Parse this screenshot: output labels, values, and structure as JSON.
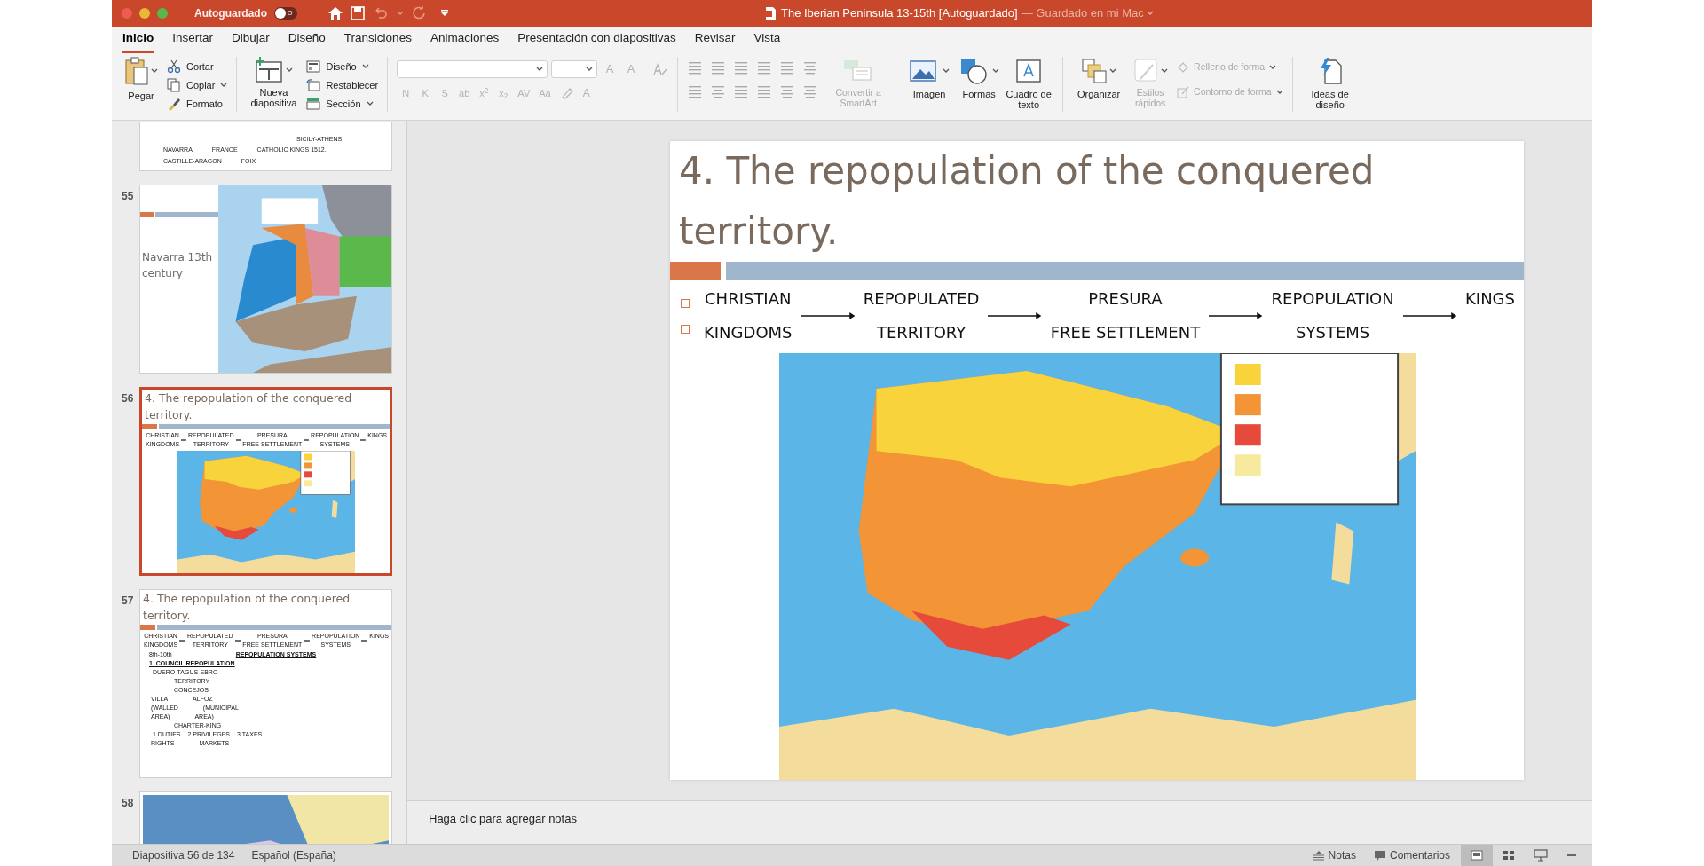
{
  "window": {
    "autosave_label": "Autoguardado",
    "autosave_on": false,
    "autosave_toggle_text": "O",
    "title": "The Iberian Peninsula 13-15th [Autoguardado]",
    "save_status": "— Guardado en mi Mac"
  },
  "tabs": [
    {
      "label": "Inicio",
      "selected": true
    },
    {
      "label": "Insertar",
      "selected": false
    },
    {
      "label": "Dibujar",
      "selected": false
    },
    {
      "label": "Diseño",
      "selected": false
    },
    {
      "label": "Transiciones",
      "selected": false
    },
    {
      "label": "Animaciones",
      "selected": false
    },
    {
      "label": "Presentación con diapositivas",
      "selected": false
    },
    {
      "label": "Revisar",
      "selected": false
    },
    {
      "label": "Vista",
      "selected": false
    }
  ],
  "ribbon": {
    "paste": {
      "label": "Pegar"
    },
    "clipboard": [
      {
        "kind": "cut",
        "label": "Cortar",
        "menu": false
      },
      {
        "kind": "copy",
        "label": "Copiar",
        "menu": true
      },
      {
        "kind": "format",
        "label": "Formato",
        "menu": false
      }
    ],
    "new_slide": {
      "label": "Nueva diapositiva"
    },
    "slide_tools": [
      {
        "kind": "layout",
        "label": "Diseño"
      },
      {
        "kind": "reset",
        "label": "Restablecer"
      },
      {
        "kind": "section",
        "label": "Sección"
      }
    ],
    "font_size_buttons": [
      "A",
      "A"
    ],
    "format_buttons": [
      "N",
      "K",
      "S",
      "ab",
      "x$^{2}$",
      "x$_{2}$",
      "AV",
      "Aa"
    ],
    "font_color_button": "A",
    "convert": {
      "label": "Convertir a SmartArt",
      "disabled": true
    },
    "insert": [
      {
        "kind": "picture",
        "label": "Imagen"
      },
      {
        "kind": "shapes",
        "label": "Formas"
      },
      {
        "kind": "textbox",
        "label": "Cuadro de texto"
      }
    ],
    "arrange": {
      "label": "Organizar",
      "disabled": false
    },
    "quick_styles": {
      "label": "Estilos rápidos",
      "disabled": true
    },
    "shape_options": [
      {
        "kind": "fill",
        "label": "Relleno de forma",
        "disabled": true
      },
      {
        "kind": "outline",
        "label": "Contorno de forma",
        "disabled": true
      }
    ],
    "design_ideas": {
      "label": "Ideas de diseño"
    }
  },
  "thumbnails": [
    {
      "kind": "text",
      "selected": false,
      "lines": [
        {
          "kind": "plain",
          "parts": [
            "SICILY-ATHENS"
          ]
        },
        {
          "kind": "plain",
          "parts": [
            "NAVARRA",
            "FRANCE",
            "CATHOLIC KINGS 1512."
          ]
        },
        {
          "kind": "plain",
          "parts": [
            "CASTILLE-ARAGON",
            "FOIX"
          ]
        }
      ]
    },
    {
      "kind": "map_title",
      "number": "55",
      "selected": false,
      "title": "Navarra 13th century"
    },
    {
      "kind": "flow_map",
      "number": "56",
      "selected": true,
      "title": "4. The repopulation of the conquered territory.",
      "flow": [
        {
          "top": "CHRISTIAN",
          "bottom": "KINGDOMS"
        },
        {
          "top": "REPOPULATED",
          "bottom": "TERRITORY"
        },
        {
          "top": "PRESURA",
          "bottom": "FREE SETTLEMENT"
        },
        {
          "top": "REPOPULATION",
          "bottom": "SYSTEMS"
        },
        {
          "top": "KINGS"
        }
      ]
    },
    {
      "kind": "flow_diagram",
      "number": "57",
      "selected": false,
      "title": "4. The repopulation of the conquered territory.",
      "flow": [
        {
          "top": "CHRISTIAN",
          "bottom": "KINGDOMS"
        },
        {
          "top": "REPOPULATED",
          "bottom": "TERRITORY"
        },
        {
          "top": "PRESURA",
          "bottom": "FREE SETTLEMENT"
        },
        {
          "top": "REPOPULATION",
          "bottom": "SYSTEMS"
        },
        {
          "top": "KINGS"
        }
      ],
      "lines": [
        {
          "kind": "split",
          "parts": [
            "8th-10th",
            "REPOPULATION SYSTEMS"
          ]
        },
        {
          "kind": "heading",
          "parts": [
            "1. COUNCIL REPOPULATION"
          ]
        },
        {
          "kind": "plain",
          "parts": [
            "DUERO-TAGUS-EBRO"
          ]
        },
        {
          "kind": "node",
          "parts": [
            "TERRITORY"
          ]
        },
        {
          "kind": "node",
          "parts": [
            "CONCEJOS"
          ]
        },
        {
          "kind": "pair",
          "parts": [
            "VILLA",
            "ALFOZ"
          ]
        },
        {
          "kind": "pair",
          "parts": [
            "(WALLED",
            "(MUNICIPAL"
          ]
        },
        {
          "kind": "pair",
          "parts": [
            "AREA)",
            "AREA)"
          ]
        },
        {
          "kind": "node",
          "parts": [
            "CHARTER-KING"
          ]
        },
        {
          "kind": "plain",
          "parts": [
            "1.DUTIES",
            "2.PRIVILEGES",
            "3.TAXES"
          ]
        },
        {
          "kind": "pair",
          "parts": [
            "RIGHTS",
            "MARKETS"
          ]
        }
      ]
    },
    {
      "kind": "map",
      "number": "58",
      "selected": false
    }
  ],
  "slide": {
    "title": "4. The repopulation of the conquered territory.",
    "flow": [
      {
        "top": "CHRISTIAN",
        "bottom": "KINGDOMS"
      },
      {
        "top": "REPOPULATED",
        "bottom": "TERRITORY"
      },
      {
        "top": "PRESURA",
        "bottom": "FREE SETTLEMENT"
      },
      {
        "top": "REPOPULATION",
        "bottom": "SYSTEMS"
      },
      {
        "top": "KINGS"
      }
    ]
  },
  "notes": {
    "placeholder": "Haga clic para agregar notas"
  },
  "status_bar": {
    "slide_info": "Diapositiva 56 de 134",
    "language": "Español (España)",
    "notes": "Notas",
    "comments": "Comentarios",
    "views": [
      {
        "kind": "normal",
        "selected": true
      },
      {
        "kind": "sorter",
        "selected": false
      },
      {
        "kind": "presenter",
        "selected": false
      }
    ]
  }
}
